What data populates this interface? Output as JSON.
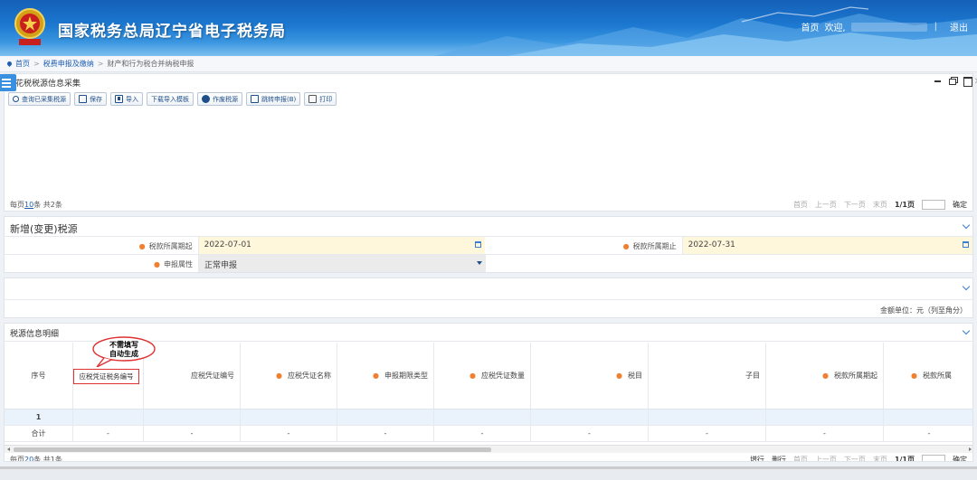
{
  "header": {
    "site_title": "国家税务总局辽宁省电子税务局",
    "home_link": "首页",
    "welcome_text": "欢迎,",
    "logout_link": "退出"
  },
  "breadcrumb": {
    "items": [
      "首页",
      "税费申报及缴纳",
      "财产和行为税合并纳税申报"
    ]
  },
  "panel_source": {
    "title": "花税税源信息采集",
    "toolbar": [
      {
        "label": "查询已采集税源",
        "icon": "search-icon"
      },
      {
        "label": "保存",
        "icon": "save-icon"
      },
      {
        "label": "导入",
        "icon": "import-icon"
      },
      {
        "label": "下载导入模板",
        "icon": ""
      },
      {
        "label": "作废税源",
        "icon": "void-icon"
      },
      {
        "label": "跳转申报(B)",
        "icon": "edit-icon"
      },
      {
        "label": "打印",
        "icon": "print-icon"
      }
    ],
    "pager": {
      "per_page_prefix": "每页",
      "per_page_value": "10",
      "per_page_suffix": "条 共2条",
      "first": "首页",
      "prev": "上一页",
      "next": "下一页",
      "last": "末页",
      "page_info": "1/1页",
      "confirm": "确定"
    }
  },
  "panel_new": {
    "title": "新增(变更)税源",
    "fields": {
      "period_start_label": "税款所属期起",
      "period_start_value": "2022-07-01",
      "period_end_label": "税款所属期止",
      "period_end_value": "2022-07-31",
      "declare_attr_label": "申报属性",
      "declare_attr_value": "正常申报"
    }
  },
  "panel_amount": {
    "amount_unit": "金额单位：元（列至角分）"
  },
  "panel_detail": {
    "title": "税源信息明细",
    "columns": [
      {
        "label": "序号",
        "required": false
      },
      {
        "label": "应税凭证税务编号",
        "required": false
      },
      {
        "label": "应税凭证编号",
        "required": false
      },
      {
        "label": "应税凭证名称",
        "required": true
      },
      {
        "label": "申报期限类型",
        "required": true
      },
      {
        "label": "应税凭证数量",
        "required": true
      },
      {
        "label": "税目",
        "required": true
      },
      {
        "label": "子目",
        "required": false
      },
      {
        "label": "税款所属期起",
        "required": true
      },
      {
        "label": "税款所属",
        "required": true
      }
    ],
    "row1": {
      "seq": "1"
    },
    "total_row": {
      "label": "合计",
      "dash": "-"
    },
    "pager": {
      "per_page_prefix": "每页",
      "per_page_value": "20",
      "per_page_suffix": "条 共1条",
      "add_row": "增行",
      "del_row": "删行",
      "first": "首页",
      "prev": "上一页",
      "next": "下一页",
      "last": "末页",
      "page_info": "1/1页",
      "confirm": "确定"
    }
  },
  "annotation": {
    "callout_line1": "不需填写",
    "callout_line2": "自动生成"
  }
}
